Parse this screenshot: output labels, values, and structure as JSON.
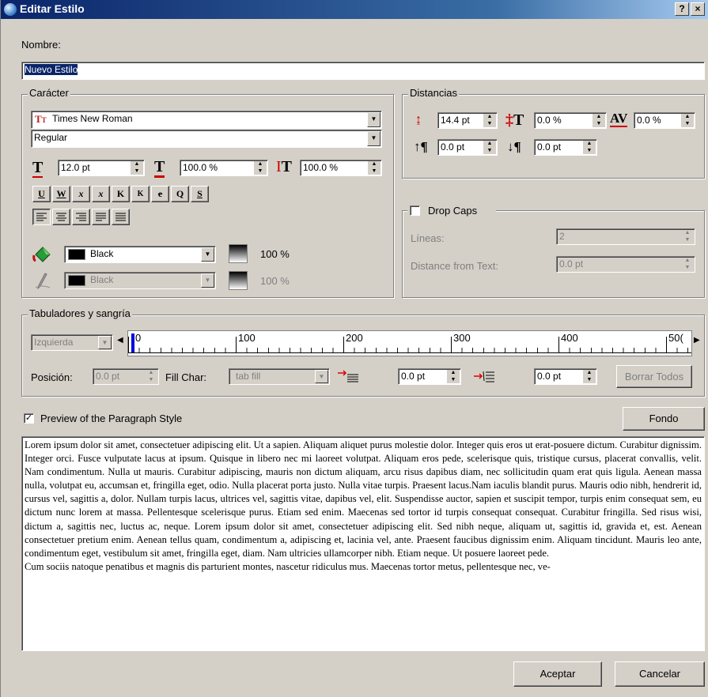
{
  "window": {
    "title": "Editar Estilo",
    "help_btn": "?",
    "close_btn": "×"
  },
  "nombre": {
    "label": "Nombre:",
    "value": "Nuevo Estilo"
  },
  "caracter": {
    "title": "Carácter",
    "font": "Times New Roman",
    "style": "Regular",
    "size": "12.0 pt",
    "scale_h": "100.0 %",
    "scale_v": "100.0 %",
    "format_buttons": [
      "U",
      "W",
      "x",
      "x",
      "K",
      "K",
      "e",
      "Q",
      "S"
    ],
    "fill_color": "Black",
    "fill_shade": "100 %",
    "stroke_color": "Black",
    "stroke_shade": "100 %"
  },
  "distancias": {
    "title": "Distancias",
    "line_spacing": "14.4 pt",
    "baseline_offset": "0.0 %",
    "tracking": "0.0 %",
    "space_before": "0.0 pt",
    "space_after": "0.0 pt"
  },
  "drop_caps": {
    "label": "Drop Caps",
    "lines_label": "Líneas:",
    "lines_value": "2",
    "distance_label": "Distance from Text:",
    "distance_value": "0.0 pt"
  },
  "tabs": {
    "title": "Tabuladores y sangría",
    "alignment": "Izquierda",
    "ruler_labels": [
      "0",
      "100",
      "200",
      "300",
      "400",
      "50("
    ],
    "position_label": "Posición:",
    "position_value": "0.0 pt",
    "fill_char_label": "Fill Char:",
    "fill_char_value": "tab fill",
    "first_indent": "0.0 pt",
    "right_indent": "0.0 pt",
    "clear_all": "Borrar Todos"
  },
  "preview": {
    "checkbox_label": "Preview of the Paragraph Style",
    "background_button": "Fondo",
    "paragraphs": [
      "Lorem ipsum dolor sit amet, consectetuer adipiscing elit. Ut a sapien. Aliquam aliquet purus molestie dolor. Integer quis eros ut erat-posuere dictum. Curabitur dignissim. Integer orci. Fusce vulputate lacus at ipsum. Quisque in libero nec mi laoreet volutpat. Aliquam eros pede, scelerisque quis, tristique cursus, placerat convallis, velit. Nam condimentum. Nulla ut mauris. Curabitur adipiscing, mauris non dictum aliquam, arcu risus dapibus diam, nec sollicitudin quam erat quis ligula. Aenean massa nulla, volutpat eu, accumsan et, fringilla eget, odio. Nulla placerat porta justo. Nulla vitae turpis. Praesent lacus.Nam iaculis blandit purus. Mauris odio nibh, hendrerit id, cursus vel, sagittis a, dolor. Nullam turpis lacus, ultrices vel, sagittis vitae, dapibus vel, elit. Suspendisse auctor, sapien et suscipit tempor, turpis enim consequat sem, eu dictum nunc lorem at massa. Pellentesque scelerisque purus. Etiam sed enim. Maecenas sed tortor id turpis consequat consequat. Curabitur fringilla. Sed risus wisi, dictum a, sagittis nec, luctus ac, neque. Lorem ipsum dolor sit amet, consectetuer adipiscing elit. Sed nibh neque, aliquam ut, sagittis id, gravida et, est. Aenean consectetuer pretium enim. Aenean tellus quam, condimentum a, adipiscing et, lacinia vel, ante. Praesent faucibus dignissim enim. Aliquam tincidunt. Mauris leo ante, condimentum eget, vestibulum sit amet, fringilla eget, diam. Nam ultricies ullamcorper nibh. Etiam neque. Ut posuere laoreet pede.",
      "Cum sociis natoque penatibus et magnis dis parturient montes, nascetur ridiculus mus. Maecenas tortor metus, pellentesque nec, ve-"
    ]
  },
  "footer": {
    "accept": "Aceptar",
    "cancel": "Cancelar"
  }
}
